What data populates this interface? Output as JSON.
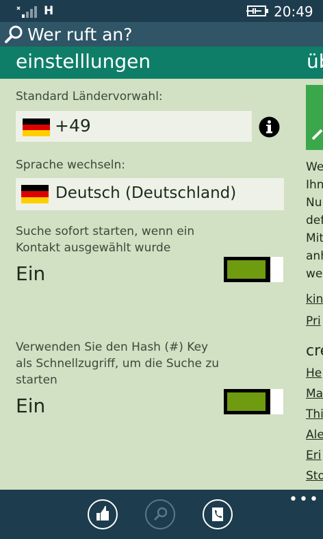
{
  "status_bar": {
    "network": "H",
    "time": "20:49",
    "icons": [
      "signal-icon",
      "battery-charging-icon"
    ]
  },
  "title_bar": {
    "title": "Wer ruft an?",
    "icon": "search-icon"
  },
  "pivot": {
    "active": "einstelllungen",
    "next": "üb"
  },
  "settings": {
    "country_label": "Standard Ländervorwahl:",
    "country_code": "+49",
    "language_label": "Sprache wechseln:",
    "language_value": "Deutsch (Deutschland)",
    "search_toggle_label": "Suche sofort starten, wenn ein Kontakt ausgewählt wurde",
    "search_toggle_value": "Ein",
    "search_toggle_on": true,
    "hash_toggle_label": "Verwenden Sie den Hash (#) Key als Schnellzugriff, um die Suche zu starten",
    "hash_toggle_value": "Ein",
    "hash_toggle_on": true
  },
  "peek": {
    "lines": [
      "We",
      "Ihn",
      "Nu",
      "def",
      "Mit",
      "anh",
      "we"
    ],
    "links_top": [
      "kin",
      "Pri"
    ],
    "heading": "cre",
    "links_bottom": [
      "He",
      "Ma",
      "Thi",
      "Ale",
      "Eri",
      "Sto"
    ]
  },
  "app_bar": {
    "buttons": [
      "like-icon",
      "search-icon",
      "contacts-icon"
    ],
    "more": "•••"
  },
  "colors": {
    "status_bar": "#1d3c4e",
    "title_bar": "#2f5566",
    "pivot_bar": "#0e7e68",
    "background": "#d2e0c3",
    "toggle_on": "#6e9b10"
  }
}
